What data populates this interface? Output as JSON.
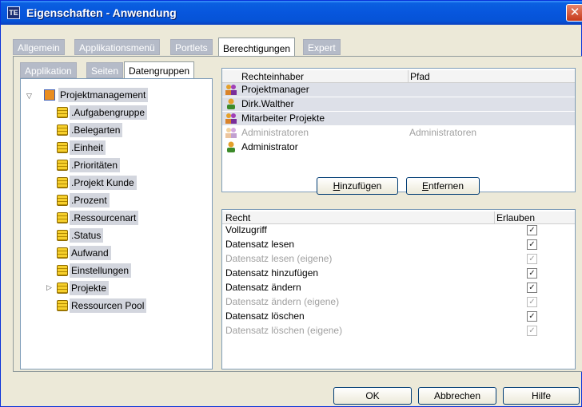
{
  "window": {
    "title": "Eigenschaften - Anwendung",
    "close_symbol": "✕"
  },
  "tabs": [
    {
      "label": "Allgemein",
      "active": false
    },
    {
      "label": "Applikationsmenü",
      "active": false
    },
    {
      "label": "Portlets",
      "active": false
    },
    {
      "label": "Berechtigungen",
      "active": true
    },
    {
      "label": "Expert",
      "active": false
    }
  ],
  "subtabs": [
    {
      "label": "Applikation",
      "active": false
    },
    {
      "label": "Seiten",
      "active": false
    },
    {
      "label": "Datengruppen",
      "active": true
    }
  ],
  "tree": {
    "root": {
      "label": "Projektmanagement",
      "icon": "project-icon",
      "expanded": true
    },
    "children": [
      {
        "label": ".Aufgabengruppe",
        "icon": "database-icon"
      },
      {
        "label": ".Belegarten",
        "icon": "database-icon"
      },
      {
        "label": ".Einheit",
        "icon": "database-icon"
      },
      {
        "label": ".Prioritäten",
        "icon": "database-icon"
      },
      {
        "label": ".Projekt Kunde",
        "icon": "database-icon"
      },
      {
        "label": ".Prozent",
        "icon": "database-icon"
      },
      {
        "label": ".Ressourcenart",
        "icon": "database-icon"
      },
      {
        "label": ".Status",
        "icon": "database-icon"
      },
      {
        "label": "Aufwand",
        "icon": "database-icon"
      },
      {
        "label": "Einstellungen",
        "icon": "database-icon"
      },
      {
        "label": "Projekte",
        "icon": "database-icon",
        "expandable": true
      },
      {
        "label": "Ressourcen Pool",
        "icon": "database-icon"
      }
    ]
  },
  "owners_table": {
    "headers": [
      "Rechteinhaber",
      "Pfad"
    ],
    "rows": [
      {
        "name": "Projektmanager",
        "path": "",
        "icon": "group-icon",
        "selected": true,
        "greyed": false
      },
      {
        "name": "Dirk.Walther",
        "path": "",
        "icon": "user-icon",
        "selected": true,
        "greyed": false
      },
      {
        "name": "Mitarbeiter Projekte",
        "path": "",
        "icon": "group-icon",
        "selected": true,
        "greyed": false
      },
      {
        "name": "Administratoren",
        "path": "Administratoren",
        "icon": "group-icon",
        "selected": false,
        "greyed": true
      },
      {
        "name": "Administrator",
        "path": "",
        "icon": "user-icon",
        "selected": false,
        "greyed": false
      }
    ]
  },
  "buttons": {
    "add": {
      "prefix": "",
      "underline": "H",
      "rest": "inzufügen"
    },
    "remove": {
      "prefix": "",
      "underline": "E",
      "rest": "ntfernen"
    },
    "ok": "OK",
    "cancel": "Abbrechen",
    "help": "Hilfe"
  },
  "rights_table": {
    "headers": [
      "Recht",
      "Erlauben"
    ],
    "rows": [
      {
        "label": "Vollzugriff",
        "checked": true,
        "greyed": false
      },
      {
        "label": "Datensatz lesen",
        "checked": true,
        "greyed": false
      },
      {
        "label": "Datensatz lesen (eigene)",
        "checked": true,
        "greyed": true
      },
      {
        "label": "Datensatz hinzufügen",
        "checked": true,
        "greyed": false
      },
      {
        "label": "Datensatz ändern",
        "checked": true,
        "greyed": false
      },
      {
        "label": "Datensatz ändern (eigene)",
        "checked": true,
        "greyed": true
      },
      {
        "label": "Datensatz löschen",
        "checked": true,
        "greyed": false
      },
      {
        "label": "Datensatz löschen (eigene)",
        "checked": true,
        "greyed": true
      }
    ],
    "check_symbol": "✓"
  },
  "colors": {
    "titlebar": "#0756dd",
    "selection": "#dde0e8",
    "greyed_text": "#a0a0a0"
  }
}
